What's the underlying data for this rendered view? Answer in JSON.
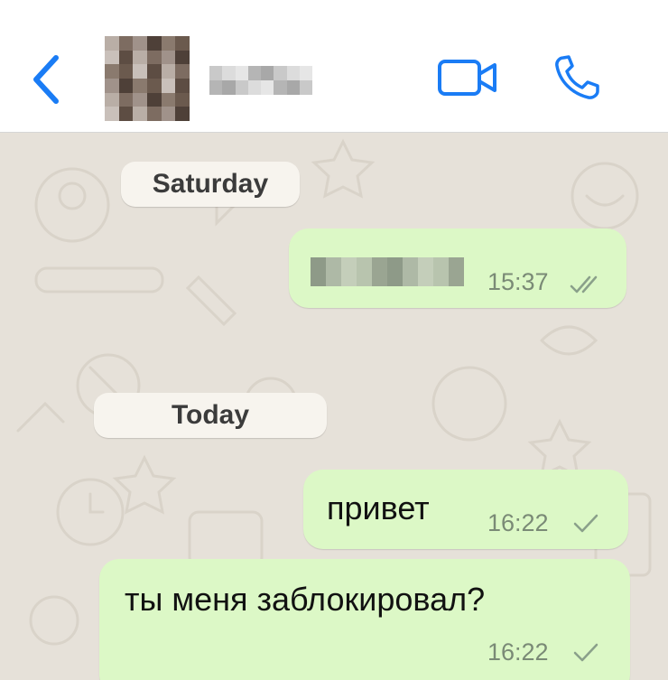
{
  "header": {
    "back_icon": "chevron-left-icon",
    "video_icon": "video-camera-icon",
    "call_icon": "phone-icon",
    "accent_color": "#1a7cf5"
  },
  "chat": {
    "background_color": "#e6e1d9",
    "bubble_color": "#dcf8c6",
    "days": [
      {
        "label": "Saturday",
        "messages": [
          {
            "text": "",
            "time": "15:37",
            "status": "read"
          }
        ]
      },
      {
        "label": "Today",
        "messages": [
          {
            "text": "привет",
            "time": "16:22",
            "status": "delivered"
          },
          {
            "text": "ты меня заблокировал?",
            "time": "16:22",
            "status": "delivered"
          }
        ]
      }
    ]
  }
}
